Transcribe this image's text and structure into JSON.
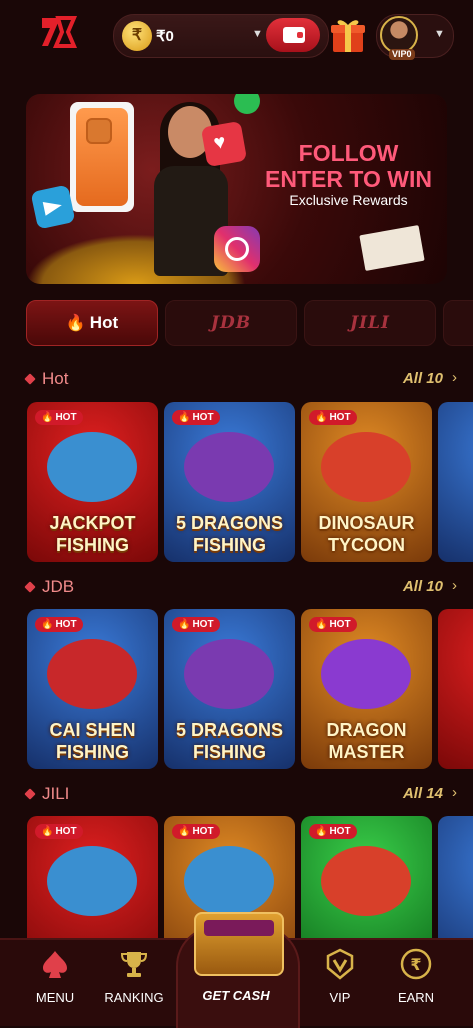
{
  "header": {
    "balance": "₹0",
    "coin_symbol": "₹",
    "vip_badge": "VIP0"
  },
  "banner": {
    "title_line1": "FOLLOW",
    "title_line2": "ENTER TO WIN",
    "subtitle": "Exclusive Rewards"
  },
  "tabs": [
    {
      "label": "Hot",
      "active": true
    },
    {
      "label": "JDB",
      "active": false
    },
    {
      "label": "JILI",
      "active": false
    }
  ],
  "sections": [
    {
      "title": "Hot",
      "all_label": "All 10",
      "games": [
        {
          "badge": "HOT",
          "name": "JACKPOT FISHING"
        },
        {
          "badge": "HOT",
          "name": "5 DRAGONS FISHING"
        },
        {
          "badge": "HOT",
          "name": "DINOSAUR TYCOON"
        }
      ]
    },
    {
      "title": "JDB",
      "all_label": "All 10",
      "games": [
        {
          "badge": "HOT",
          "name": "CAI SHEN FISHING"
        },
        {
          "badge": "HOT",
          "name": "5 DRAGONS FISHING"
        },
        {
          "badge": "HOT",
          "name": "DRAGON MASTER"
        }
      ]
    },
    {
      "title": "JILI",
      "all_label": "All 14",
      "games": [
        {
          "badge": "HOT",
          "name": ""
        },
        {
          "badge": "HOT",
          "name": ""
        },
        {
          "badge": "HOT",
          "name": ""
        }
      ]
    }
  ],
  "bottom_nav": [
    {
      "label": "MENU"
    },
    {
      "label": "RANKING"
    },
    {
      "label": "GET CASH"
    },
    {
      "label": "VIP"
    },
    {
      "label": "EARN"
    }
  ],
  "colors": {
    "background": "#1a0707",
    "accent_red": "#e0404a",
    "gold": "#e0c070"
  }
}
